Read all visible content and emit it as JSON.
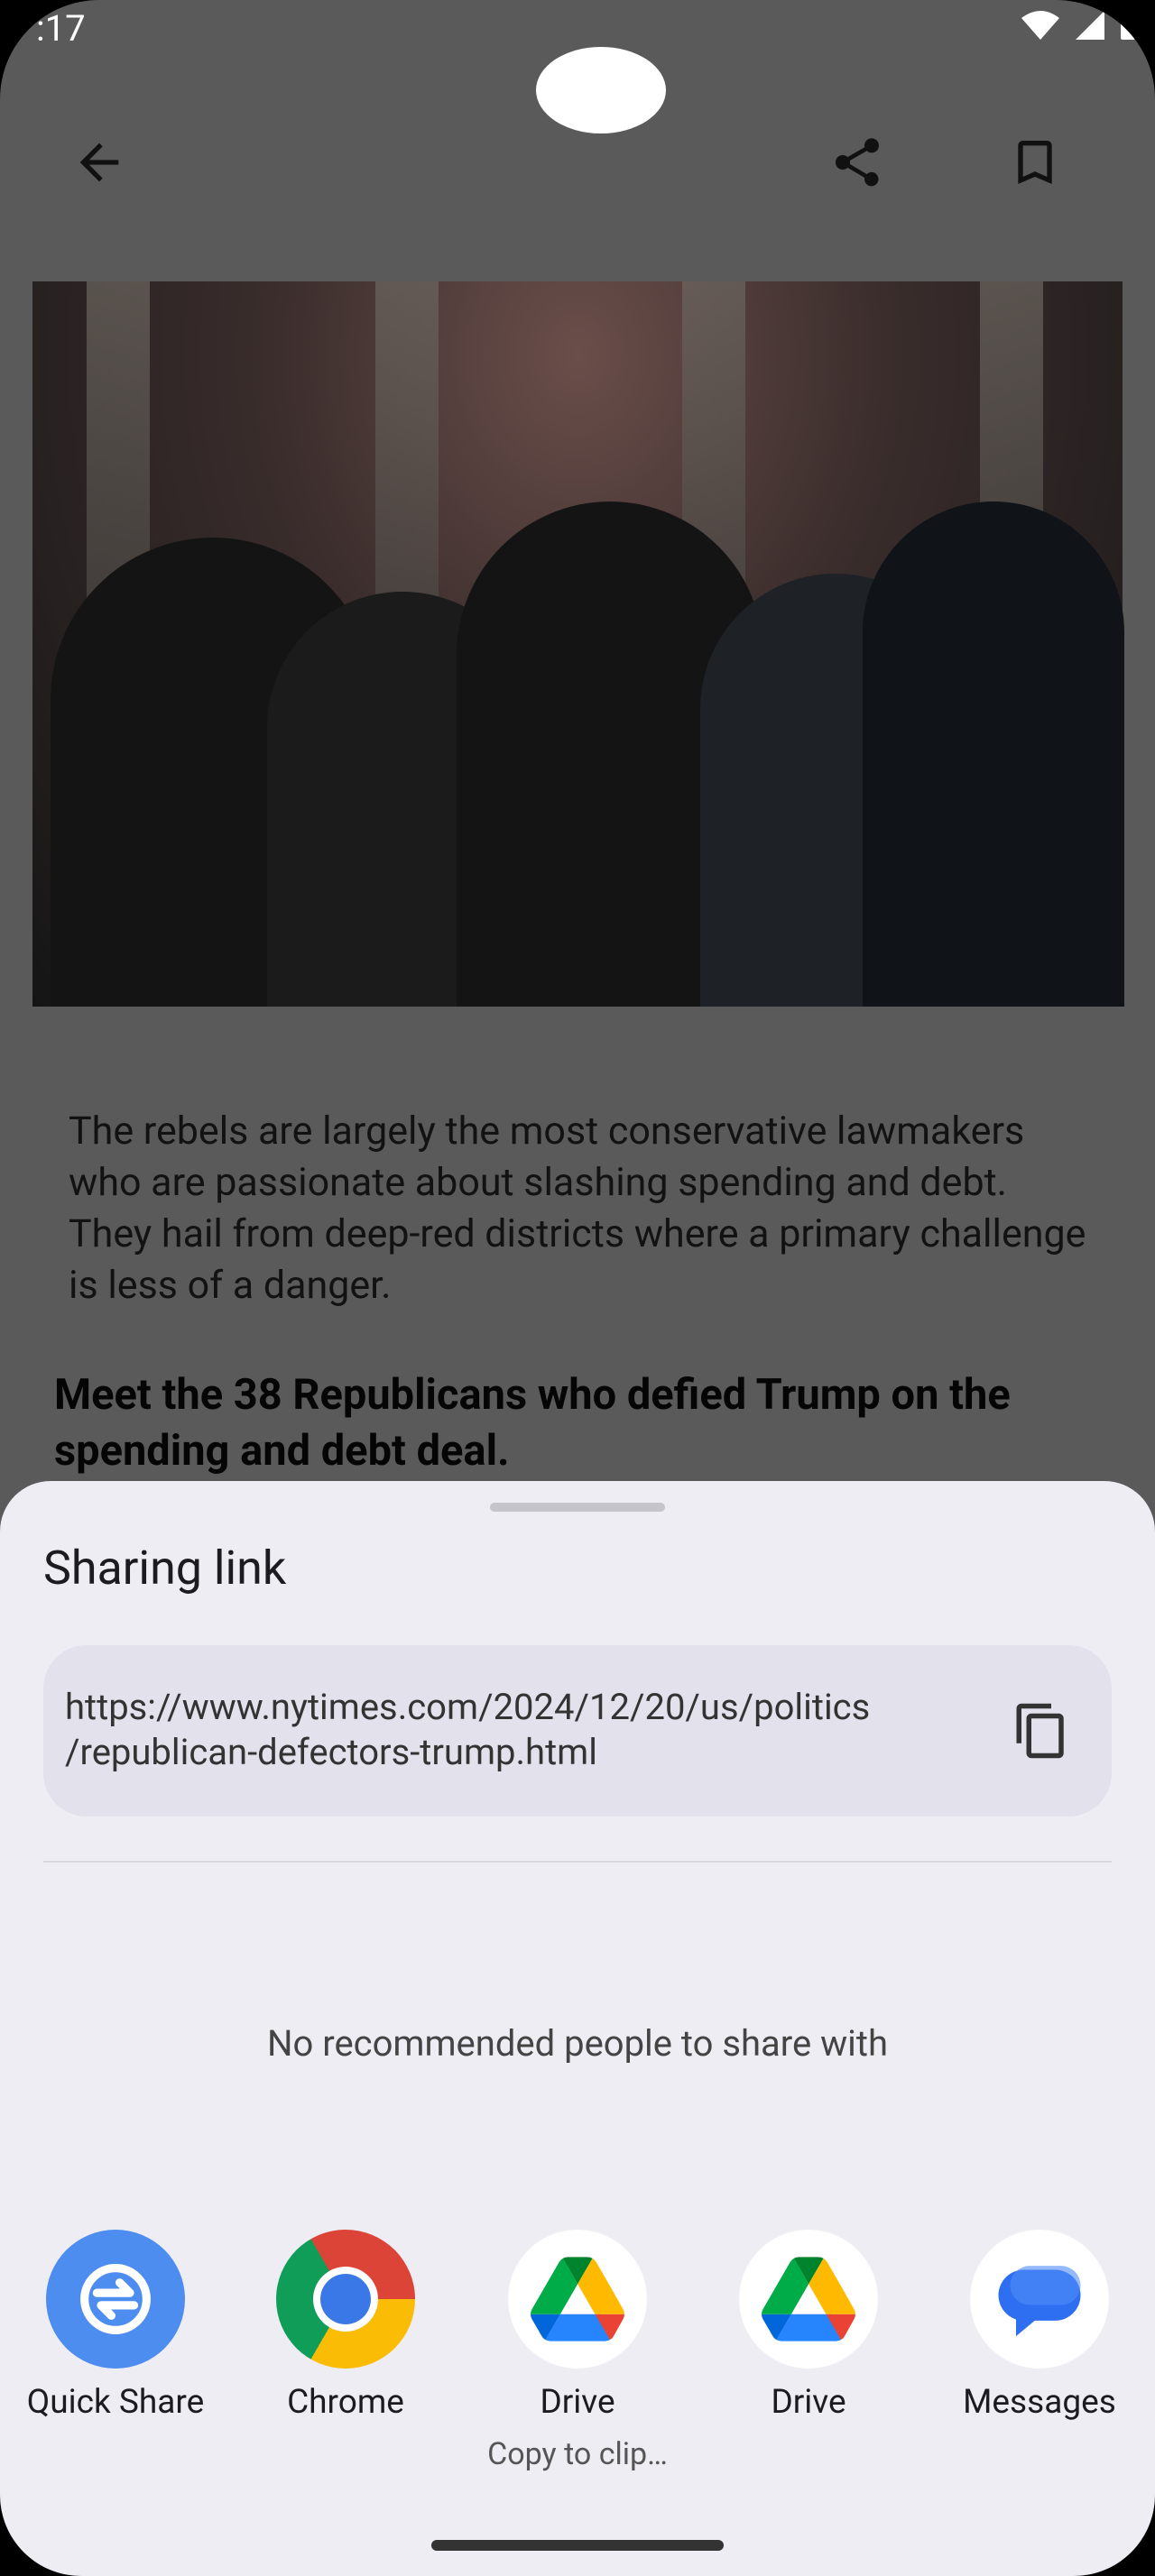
{
  "status_bar": {
    "time": ":17"
  },
  "app_bar": {
    "back_icon": "arrow-back-icon",
    "share_icon": "share-icon",
    "bookmark_icon": "bookmark-icon"
  },
  "article": {
    "body": "The rebels are largely the most conservative lawmakers who are passionate about slashing spending and debt. They hail from deep-red districts where a primary challenge is less of a danger.",
    "heading": "Meet the 38 Republicans who defied Trump on the spending and debt deal."
  },
  "share_sheet": {
    "title": "Sharing link",
    "url_line1": "https://www.nytimes.com/2024/12/20/us/politics",
    "url_line2": "/republican-defectors-trump.html",
    "no_people_text": "No recommended people to share with",
    "apps": [
      {
        "label": "Quick Share",
        "icon": "quick-share-icon"
      },
      {
        "label": "Chrome",
        "icon": "chrome-icon"
      },
      {
        "label": "Drive",
        "sub": "Copy to clip…",
        "icon": "drive-icon"
      },
      {
        "label": "Drive",
        "icon": "drive-icon"
      },
      {
        "label": "Messages",
        "icon": "messages-icon"
      }
    ]
  },
  "colors": {
    "sheet_bg": "#eeedf4",
    "quick_share_blue": "#4d8df0",
    "messages_blue": "#2e6ff2"
  }
}
